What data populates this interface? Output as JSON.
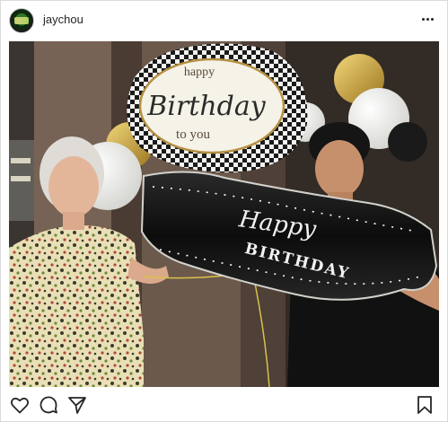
{
  "post": {
    "username": "jaychou",
    "header_icons": [
      "avatar",
      "more-options-icon"
    ],
    "action_icons": [
      "heart-icon",
      "comment-icon",
      "share-icon",
      "bookmark-icon"
    ]
  },
  "photo": {
    "top_balloon_text": [
      "happy",
      "Birthday",
      "to you"
    ],
    "banner_text": [
      "Happy",
      "BIRTHDAY"
    ]
  },
  "colors": {
    "border": "#dbdbdb",
    "text": "#262626",
    "gold": "#c9a13a",
    "balloon_white": "#f2f2f0",
    "black": "#141414"
  }
}
